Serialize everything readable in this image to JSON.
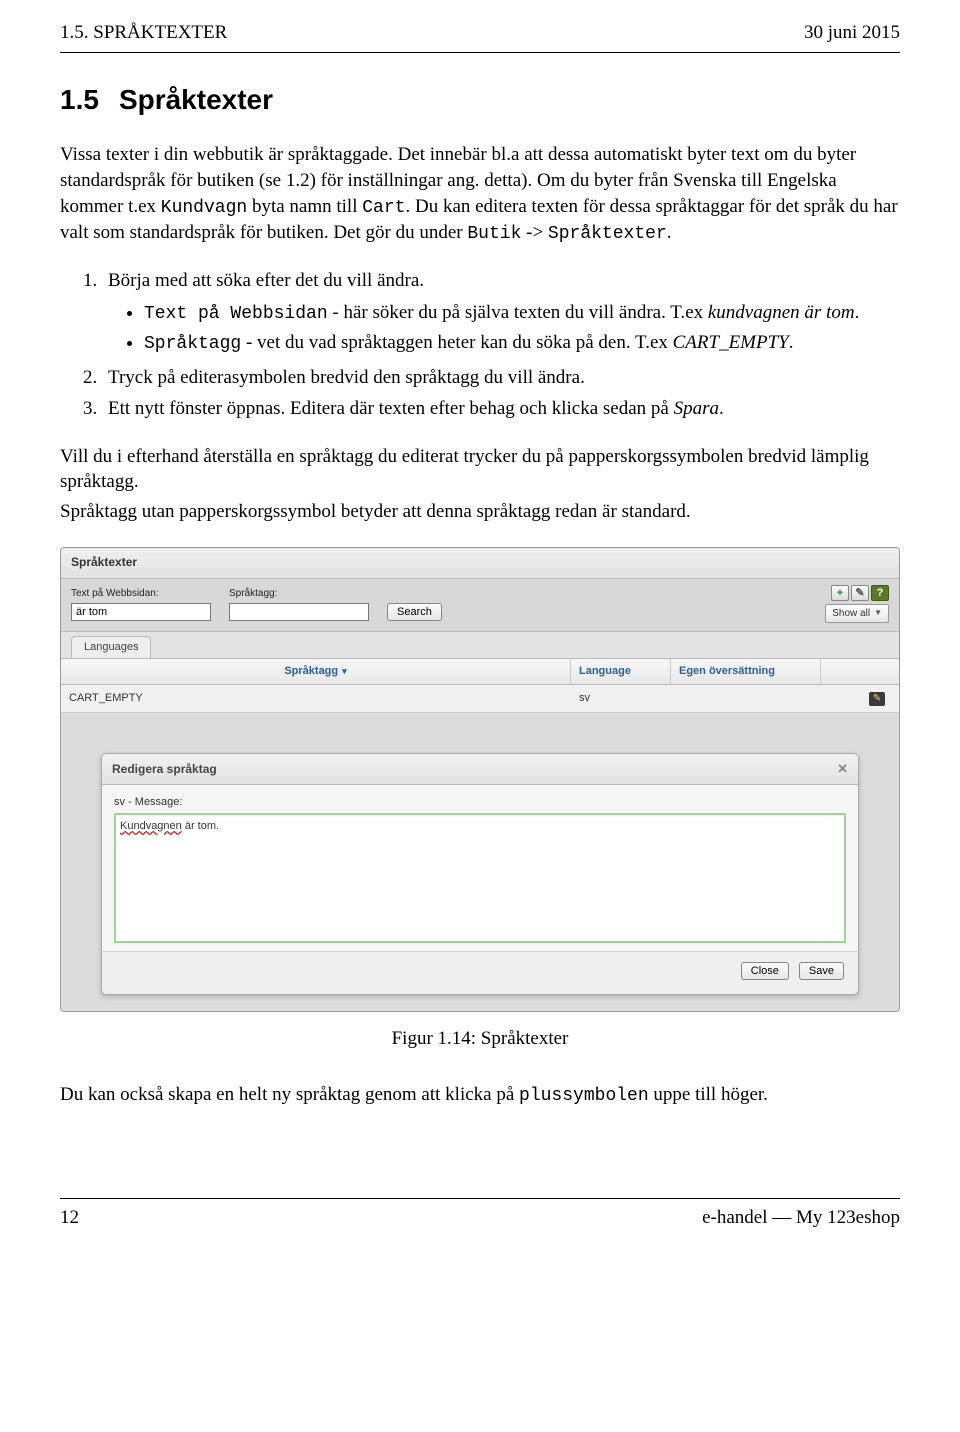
{
  "header": {
    "left": "1.5. SPRÅKTEXTER",
    "right": "30 juni 2015"
  },
  "section": {
    "number": "1.5",
    "title": "Språktexter"
  },
  "intro": {
    "p1a": "Vissa texter i din webbutik är språktaggade. Det innebär bl.a att dessa automatiskt byter text om du byter standardspråk för butiken (se ",
    "p1ref": "1.2",
    "p1b": ") för inställningar ang. detta). Om du byter från Svenska till Engelska kommer t.ex ",
    "code1": "Kundvagn",
    "p1c": " byta namn till ",
    "code2": "Cart",
    "p1d": ". Du kan editera texten för dessa språktaggar för det språk du har valt som standardspråk för butiken. Det gör du under ",
    "code3": "Butik",
    "p1e": " -> ",
    "code4": "Språktexter",
    "p1f": "."
  },
  "steps": {
    "s1": "Börja med att söka efter det du vill ändra.",
    "b1_code": "Text på Webbsidan",
    "b1_mid": " - här söker du på själva texten du vill ändra. T.ex ",
    "b1_it": "kundvagnen är tom",
    "b1_end": ".",
    "b2_code": "Språktagg",
    "b2_mid": " - vet du vad språktaggen heter kan du söka på den. T.ex ",
    "b2_it": "CART_EMPTY",
    "b2_end": ".",
    "s2": "Tryck på editerasymbolen bredvid den språktagg du vill ändra.",
    "s3a": "Ett nytt fönster öppnas. Editera där texten efter behag och klicka sedan på ",
    "s3_it": "Spara",
    "s3b": "."
  },
  "after": {
    "p1": "Vill du i efterhand återställa en språktagg du editerat trycker du på papperskorgssymbolen bredvid lämplig språktagg.",
    "p2": "Språktagg utan papperskorgssymbol betyder att denna språktagg redan är standard."
  },
  "app": {
    "title": "Språktexter",
    "search": {
      "label1": "Text på Webbsidan:",
      "value1": "är tom",
      "label2": "Språktagg:",
      "value2": "",
      "button": "Search",
      "showall": "Show all"
    },
    "tab": "Languages",
    "columns": {
      "c1": "Språktagg",
      "c2": "Language",
      "c3": "Egen översättning"
    },
    "row": {
      "tag": "CART_EMPTY",
      "lang": "sv"
    },
    "modal": {
      "title": "Redigera språktag",
      "label": "sv - Message:",
      "text_underlined": "Kundvagnen",
      "text_rest": " är tom.",
      "close": "Close",
      "save": "Save"
    }
  },
  "caption": "Figur 1.14: Språktexter",
  "bottom": {
    "a": "Du kan också skapa en helt ny språktag genom att klicka på ",
    "code": "plussymbolen",
    "b": " uppe till höger."
  },
  "footer": {
    "left": "12",
    "right": "e-handel — My 123eshop"
  }
}
